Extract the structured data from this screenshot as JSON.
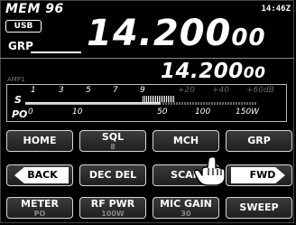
{
  "header": {
    "memory_label": "MEM 96",
    "clock": "14:46Z",
    "mode_badge": "USB",
    "group_tag": "GRP"
  },
  "frequency": {
    "main_big": "14.200",
    "main_small": "00",
    "sub_big": "14.200",
    "sub_small": "00",
    "sub_tag": "AMP1"
  },
  "meter": {
    "s_label": "S",
    "po_label": "PO",
    "s_scale": [
      "1",
      "3",
      "5",
      "7",
      "9",
      "+20",
      "+40",
      "+60dB"
    ],
    "po_scale": [
      "0",
      "10",
      "50",
      "100",
      "150W"
    ]
  },
  "buttons": {
    "row1": [
      {
        "label": "HOME",
        "sub": ""
      },
      {
        "label": "SQL",
        "sub": "8"
      },
      {
        "label": "MCH",
        "sub": ""
      },
      {
        "label": "GRP",
        "sub": ""
      }
    ],
    "row2": [
      {
        "label": "BACK",
        "sub": ""
      },
      {
        "label": "DEC DEL",
        "sub": ""
      },
      {
        "label": "SCAN",
        "sub": ""
      },
      {
        "label": "FWD",
        "sub": ""
      }
    ],
    "row3": [
      {
        "label": "METER",
        "sub": "PO"
      },
      {
        "label": "RF PWR",
        "sub": "100W"
      },
      {
        "label": "MIC GAIN",
        "sub": "30"
      },
      {
        "label": "SWEEP",
        "sub": ""
      }
    ]
  },
  "icons": {
    "pointer": "hand-pointer-icon"
  }
}
